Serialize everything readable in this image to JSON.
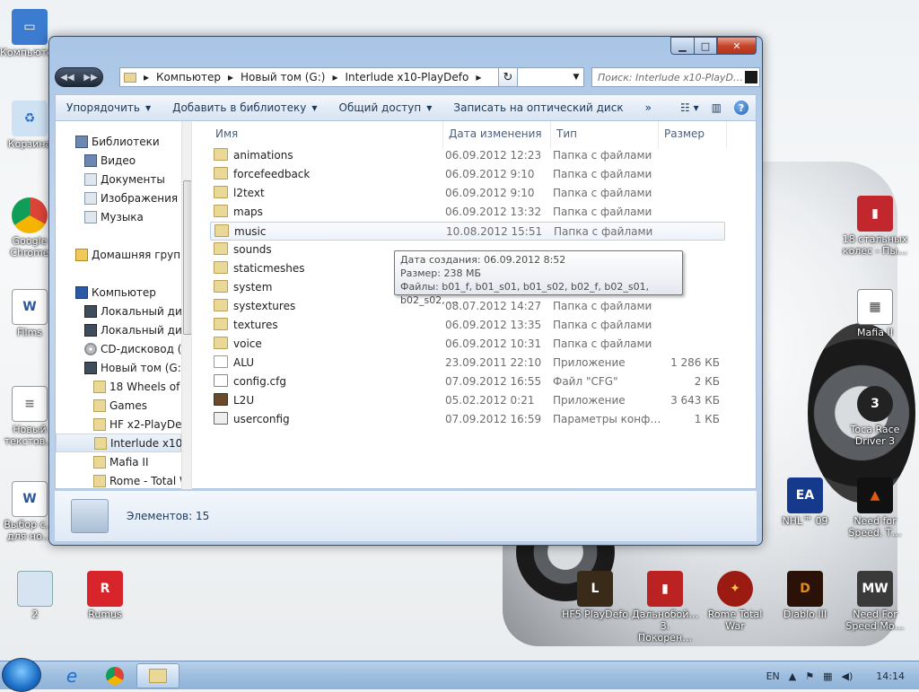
{
  "desktop": {
    "icons_left": [
      {
        "label": "Компьютер",
        "icon": "computer-icon"
      },
      {
        "label": "Корзина",
        "icon": "recycle-bin-icon"
      },
      {
        "label": "Google Chrome",
        "icon": "chrome-icon"
      },
      {
        "label": "Films",
        "icon": "word-doc-icon"
      },
      {
        "label": "Новый текстов…",
        "icon": "text-doc-icon"
      },
      {
        "label": "Выбор с… для но…",
        "icon": "word-doc-icon"
      }
    ],
    "icons_right": [
      {
        "label": "18 стальных колес - Пы…",
        "icon": "truck-game-icon"
      },
      {
        "label": "Mafia II",
        "icon": "image-icon"
      },
      {
        "label": "Toca Race Driver 3",
        "icon": "toca-icon"
      },
      {
        "label": "Need for Speed. T…",
        "icon": "nfs-icon"
      },
      {
        "label": "NHL™ 09",
        "icon": "nhl-icon"
      }
    ],
    "icons_bottom": [
      {
        "label": "2",
        "icon": "file-icon"
      },
      {
        "label": "Rumus",
        "icon": "rumus-icon"
      },
      {
        "label": "HF5 PlayDefo",
        "icon": "lineage-icon"
      },
      {
        "label": "Дальнобой… 3. Покорен…",
        "icon": "truck-icon"
      },
      {
        "label": "Rome Total War",
        "icon": "rome-icon"
      },
      {
        "label": "Diablo III",
        "icon": "diablo-icon"
      },
      {
        "label": "Need For Speed Mo…",
        "icon": "nfs-mw-icon"
      }
    ]
  },
  "window": {
    "breadcrumb": [
      "Компьютер",
      "Новый том (G:)",
      "Interlude x10-PlayDefo"
    ],
    "search_placeholder": "Поиск: Interlude x10-PlayD…",
    "toolbar": {
      "organize": "Упорядочить",
      "add_library": "Добавить в библиотеку",
      "share": "Общий доступ",
      "burn": "Записать на оптический диск",
      "more": "»"
    },
    "nav": [
      {
        "label": "Библиотеки",
        "icon": "library-icon",
        "level": 0
      },
      {
        "label": "Видео",
        "icon": "video-library-icon",
        "level": 1
      },
      {
        "label": "Документы",
        "icon": "documents-library-icon",
        "level": 1
      },
      {
        "label": "Изображения",
        "icon": "pictures-library-icon",
        "level": 1
      },
      {
        "label": "Музыка",
        "icon": "music-library-icon",
        "level": 1
      },
      {
        "label": "Домашняя группа",
        "icon": "homegroup-icon",
        "level": 0
      },
      {
        "label": "Компьютер",
        "icon": "computer-icon",
        "level": 0
      },
      {
        "label": "Локальный диск",
        "icon": "drive-icon",
        "level": 1
      },
      {
        "label": "Локальный диск",
        "icon": "drive-icon",
        "level": 1
      },
      {
        "label": "CD-дисковод (F:)",
        "icon": "cd-drive-icon",
        "level": 1
      },
      {
        "label": "Новый том (G:)",
        "icon": "drive-icon",
        "level": 1
      },
      {
        "label": "18 Wheels of St",
        "icon": "folder-icon",
        "level": 2
      },
      {
        "label": "Games",
        "icon": "folder-icon",
        "level": 2
      },
      {
        "label": "HF x2-PlayDefo",
        "icon": "folder-icon",
        "level": 2
      },
      {
        "label": "Interlude x10-P",
        "icon": "folder-icon",
        "level": 2,
        "selected": true
      },
      {
        "label": "Mafia II",
        "icon": "folder-icon",
        "level": 2
      },
      {
        "label": "Rome - Total W",
        "icon": "folder-icon",
        "level": 2
      }
    ],
    "columns": {
      "name": "Имя",
      "date": "Дата изменения",
      "type": "Тип",
      "size": "Размер"
    },
    "files": [
      {
        "name": "animations",
        "date": "06.09.2012 12:23",
        "type": "Папка с файлами",
        "size": "",
        "icon": "folder"
      },
      {
        "name": "forcefeedback",
        "date": "06.09.2012 9:10",
        "type": "Папка с файлами",
        "size": "",
        "icon": "folder"
      },
      {
        "name": "l2text",
        "date": "06.09.2012 9:10",
        "type": "Папка с файлами",
        "size": "",
        "icon": "folder"
      },
      {
        "name": "maps",
        "date": "06.09.2012 13:32",
        "type": "Папка с файлами",
        "size": "",
        "icon": "folder"
      },
      {
        "name": "music",
        "date": "10.08.2012 15:51",
        "type": "Папка с файлами",
        "size": "",
        "icon": "folder",
        "hover": true
      },
      {
        "name": "sounds",
        "date": "",
        "type": "",
        "size": "",
        "icon": "folder"
      },
      {
        "name": "staticmeshes",
        "date": "",
        "type": "",
        "size": "",
        "icon": "folder"
      },
      {
        "name": "system",
        "date": "",
        "type": "",
        "size": "",
        "icon": "folder"
      },
      {
        "name": "systextures",
        "date": "08.07.2012 14:27",
        "type": "Папка с файлами",
        "size": "",
        "icon": "folder"
      },
      {
        "name": "textures",
        "date": "06.09.2012 13:35",
        "type": "Папка с файлами",
        "size": "",
        "icon": "folder"
      },
      {
        "name": "voice",
        "date": "06.09.2012 10:31",
        "type": "Папка с файлами",
        "size": "",
        "icon": "folder"
      },
      {
        "name": "ALU",
        "date": "23.09.2011 22:10",
        "type": "Приложение",
        "size": "1 286 КБ",
        "icon": "app"
      },
      {
        "name": "config.cfg",
        "date": "07.09.2012 16:55",
        "type": "Файл \"CFG\"",
        "size": "2 КБ",
        "icon": "cfg"
      },
      {
        "name": "L2U",
        "date": "05.02.2012 0:21",
        "type": "Приложение",
        "size": "3 643 КБ",
        "icon": "img"
      },
      {
        "name": "userconfig",
        "date": "07.09.2012 16:59",
        "type": "Параметры конф…",
        "size": "1 КБ",
        "icon": "gear"
      }
    ],
    "tooltip": {
      "created": "Дата создания: 06.09.2012 8:52",
      "size": "Размер: 238 МБ",
      "files": "Файлы: b01_f, b01_s01, b01_s02, b02_f, b02_s01, b02_s02, …"
    },
    "status": "Элементов: 15"
  },
  "taskbar": {
    "language": "EN",
    "clock": "14:14"
  }
}
